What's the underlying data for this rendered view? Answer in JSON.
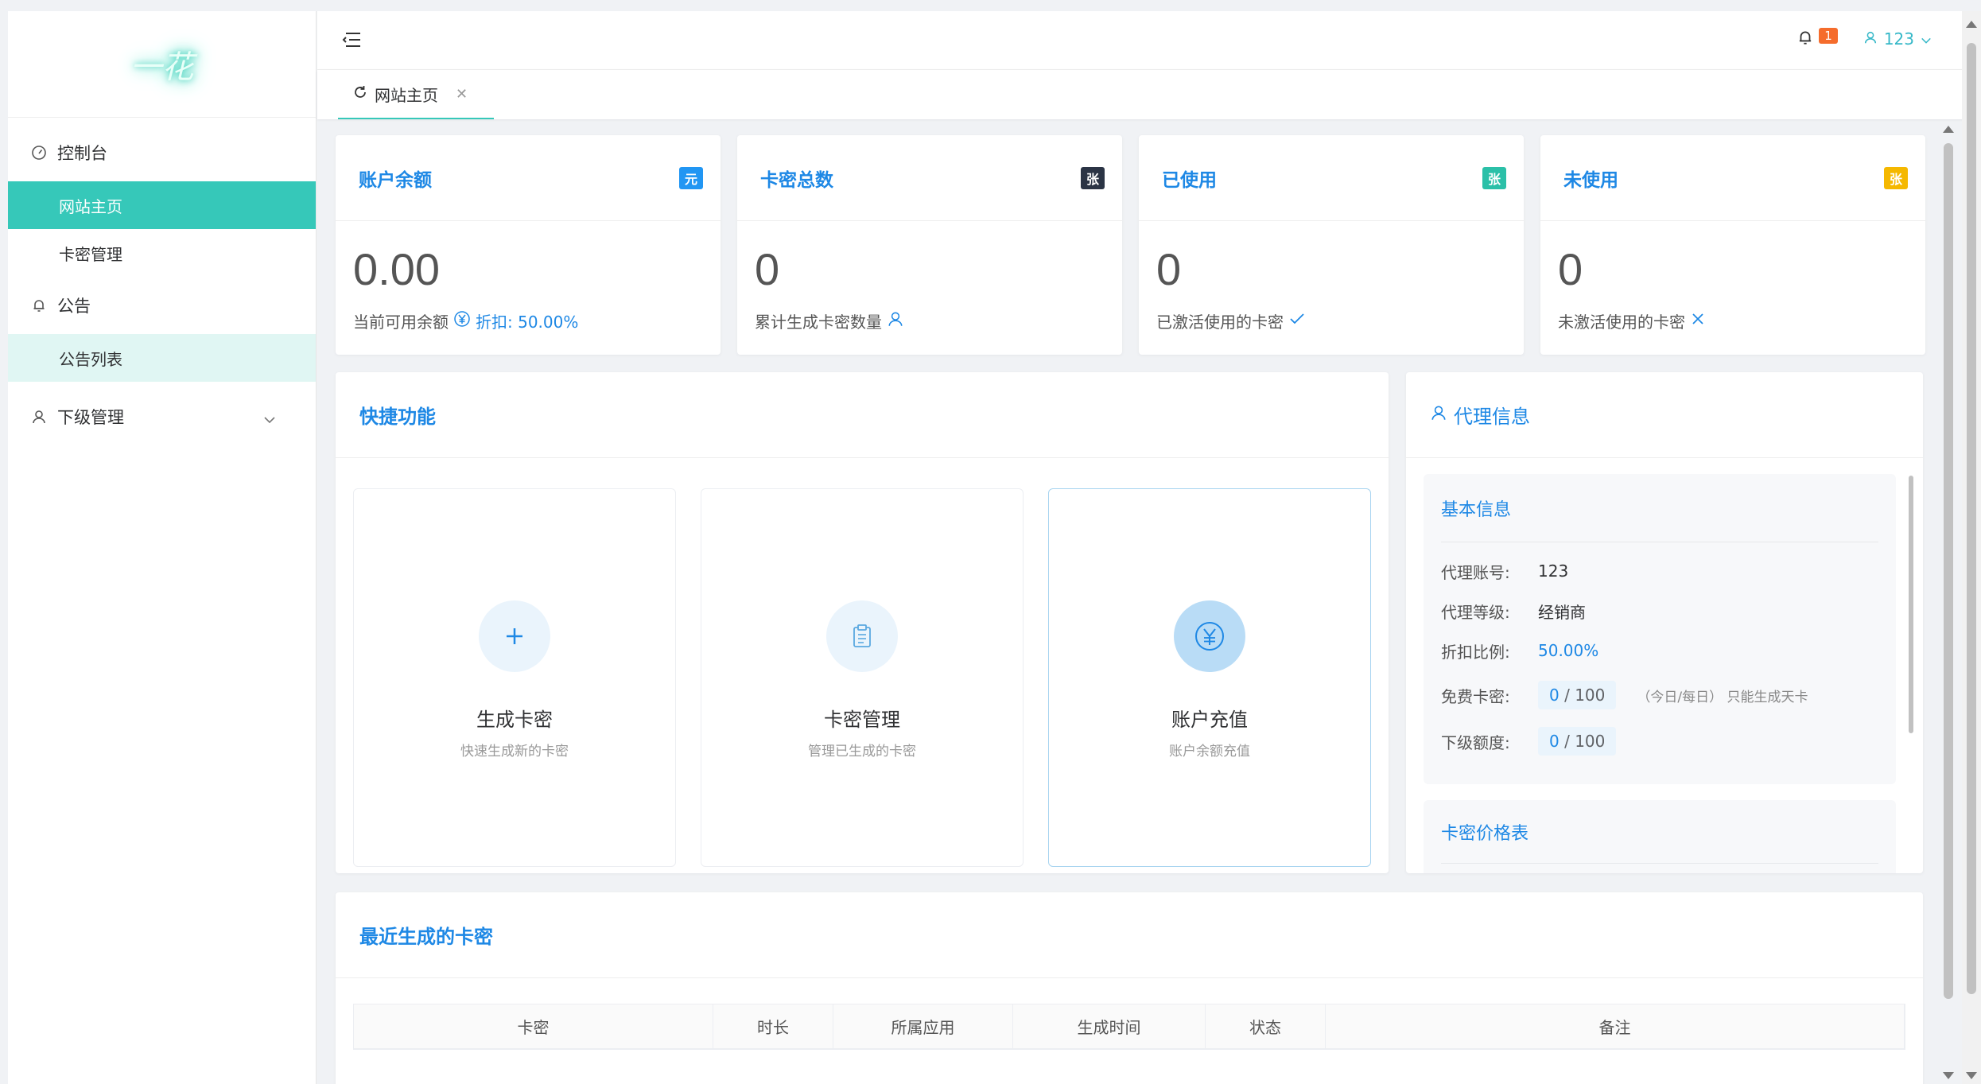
{
  "logo": {
    "text": "一花"
  },
  "sidebar": {
    "dashboard": "控制台",
    "home": "网站主页",
    "card_manage": "卡密管理",
    "notice": "公告",
    "notice_list": "公告列表",
    "sub_manage": "下级管理"
  },
  "header": {
    "notifications": "1",
    "username": "123"
  },
  "tabs": {
    "home": "网站主页"
  },
  "stats": [
    {
      "title": "账户余额",
      "tag": "元",
      "tag_color": "#2196f3",
      "value": "0.00",
      "sub": "当前可用余额",
      "extra": "折扣: 50.00%"
    },
    {
      "title": "卡密总数",
      "tag": "张",
      "tag_color": "#2b3445",
      "value": "0",
      "sub": "累计生成卡密数量"
    },
    {
      "title": "已使用",
      "tag": "张",
      "tag_color": "#2bc0a8",
      "value": "0",
      "sub": "已激活使用的卡密"
    },
    {
      "title": "未使用",
      "tag": "张",
      "tag_color": "#f5b800",
      "value": "0",
      "sub": "未激活使用的卡密"
    }
  ],
  "quick": {
    "title": "快捷功能",
    "items": [
      {
        "name": "生成卡密",
        "desc": "快速生成新的卡密"
      },
      {
        "name": "卡密管理",
        "desc": "管理已生成的卡密"
      },
      {
        "name": "账户充值",
        "desc": "账户余额充值"
      }
    ]
  },
  "agent": {
    "title": "代理信息",
    "basic_title": "基本信息",
    "account_label": "代理账号:",
    "account": "123",
    "level_label": "代理等级:",
    "level": "经销商",
    "discount_label": "折扣比例:",
    "discount": "50.00%",
    "free_label": "免费卡密:",
    "free_used": "0",
    "free_total": "100",
    "free_hint": "（今日/每日） 只能生成天卡",
    "sub_label": "下级额度:",
    "sub_used": "0",
    "sub_total": "100",
    "price_title": "卡密价格表"
  },
  "recent": {
    "title": "最近生成的卡密",
    "columns": [
      "卡密",
      "时长",
      "所属应用",
      "生成时间",
      "状态",
      "备注"
    ]
  }
}
